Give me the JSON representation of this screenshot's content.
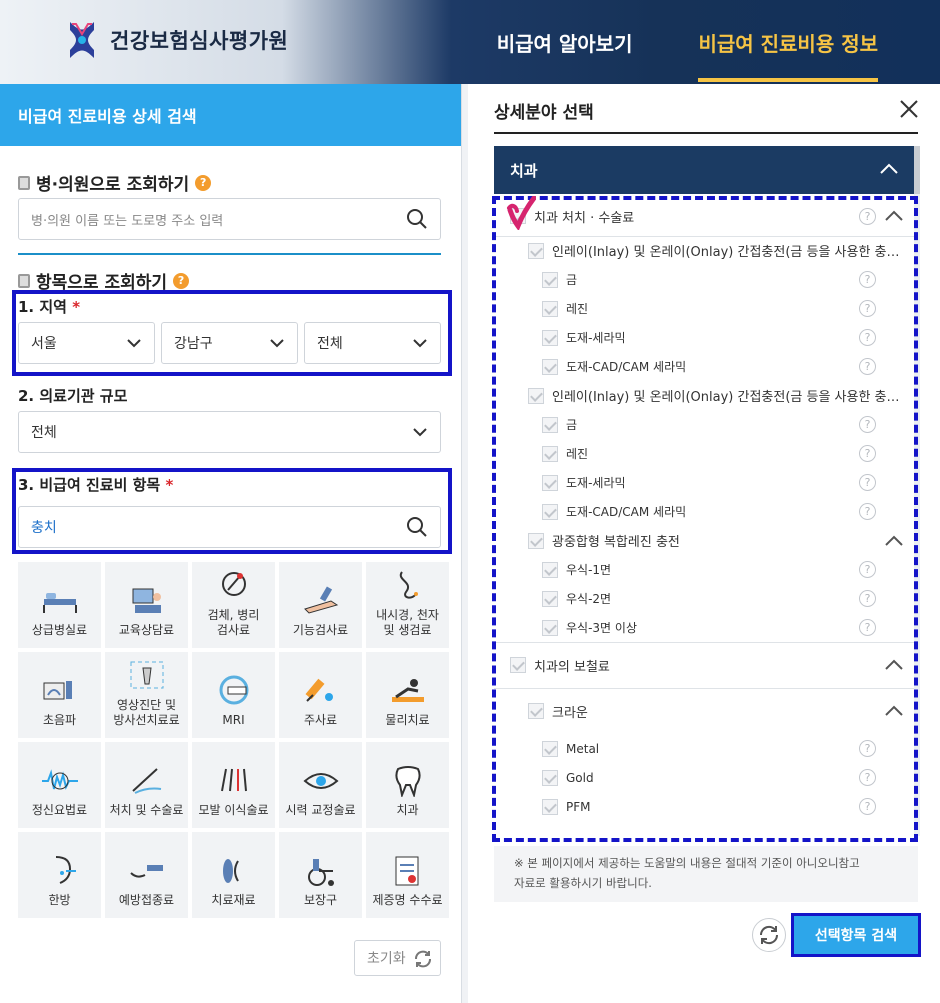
{
  "header": {
    "org_name": "건강보험심사평가원",
    "nav": [
      "비급여 알아보기",
      "비급여 진료비용 정보"
    ],
    "active_nav": 1
  },
  "left": {
    "panel_title": "비급여 진료비용 상세 검색",
    "hospital_section": {
      "title": "병·의원으로 조회하기",
      "placeholder": "병·의원 이름 또는 도로명 주소 입력"
    },
    "item_section": {
      "title": "항목으로 조회하기"
    },
    "region": {
      "label": "1. 지역",
      "required": "*",
      "selects": [
        "서울",
        "강남구",
        "전체"
      ]
    },
    "scale": {
      "label": "2. 의료기관 규모",
      "value": "전체"
    },
    "item": {
      "label": "3. 비급여 진료비 항목",
      "required": "*",
      "value": "충치"
    },
    "categories": [
      {
        "label": "상급병실료",
        "icon": "hospital-bed-icon"
      },
      {
        "label": "교육상담료",
        "icon": "consultation-icon"
      },
      {
        "label": "검체, 병리\n검사료",
        "icon": "microscope-icon"
      },
      {
        "label": "기능검사료",
        "icon": "arm-test-icon"
      },
      {
        "label": "내시경, 천자\n및 생검료",
        "icon": "endoscope-icon"
      },
      {
        "label": "초음파",
        "icon": "ultrasound-icon"
      },
      {
        "label": "영상진단 및\n방사선치료료",
        "icon": "xray-icon"
      },
      {
        "label": "MRI",
        "icon": "mri-icon"
      },
      {
        "label": "주사료",
        "icon": "syringe-icon"
      },
      {
        "label": "물리치료",
        "icon": "physical-therapy-icon"
      },
      {
        "label": "정신요법료",
        "icon": "brain-wave-icon"
      },
      {
        "label": "처치 및 수술료",
        "icon": "surgery-icon"
      },
      {
        "label": "모발 이식술료",
        "icon": "hair-transplant-icon"
      },
      {
        "label": "시력 교정술료",
        "icon": "eye-icon"
      },
      {
        "label": "치과",
        "icon": "tooth-icon"
      },
      {
        "label": "한방",
        "icon": "acupuncture-ear-icon"
      },
      {
        "label": "예방접종료",
        "icon": "vaccine-icon"
      },
      {
        "label": "치료재료",
        "icon": "lens-icon"
      },
      {
        "label": "보장구",
        "icon": "wheelchair-icon"
      },
      {
        "label": "제증명 수수료",
        "icon": "certificate-icon"
      }
    ],
    "reset_label": "초기화"
  },
  "right": {
    "title": "상세분야 선택",
    "group_title": "치과",
    "tree": [
      {
        "level": 0,
        "text": "치과 처치 · 수술료",
        "help": true,
        "collapse": true
      },
      {
        "level": 1,
        "text": "인레이(Inlay) 및 온레이(Onlay) 간접충전(금 등을 사용한 충전…",
        "help": false
      },
      {
        "level": 2,
        "text": "금",
        "help": true
      },
      {
        "level": 2,
        "text": "레진",
        "help": true
      },
      {
        "level": 2,
        "text": "도재-세라믹",
        "help": true
      },
      {
        "level": 2,
        "text": "도재-CAD/CAM 세라믹",
        "help": true
      },
      {
        "level": 1,
        "text": "인레이(Inlay) 및 온레이(Onlay) 간접충전(금 등을 사용한 충전…",
        "help": false
      },
      {
        "level": 2,
        "text": "금",
        "help": true
      },
      {
        "level": 2,
        "text": "레진",
        "help": true
      },
      {
        "level": 2,
        "text": "도재-세라믹",
        "help": true
      },
      {
        "level": 2,
        "text": "도재-CAD/CAM 세라믹",
        "help": true
      },
      {
        "level": 1,
        "text": "광중합형 복합레진 충전",
        "help": false,
        "collapse": true
      },
      {
        "level": 2,
        "text": "우식-1면",
        "help": true
      },
      {
        "level": 2,
        "text": "우식-2면",
        "help": true
      },
      {
        "level": 2,
        "text": "우식-3면 이상",
        "help": true
      },
      {
        "level": 0,
        "text": "치과의 보철료",
        "help": false,
        "collapse": true
      },
      {
        "level": 1,
        "text": "크라운",
        "help": false,
        "collapse": true
      },
      {
        "level": 2,
        "text": "Metal",
        "help": true
      },
      {
        "level": 2,
        "text": "Gold",
        "help": true
      },
      {
        "level": 2,
        "text": "PFM",
        "help": true
      }
    ],
    "notice_line1": "※ 본 페이지에서 제공하는 도움말의 내용은 절대적 기준이 아니오니참고",
    "notice_line2": "자료로 활용하시기 바랍니다.",
    "search_selected_label": "선택항목 검색",
    "help_glyph": "?"
  },
  "colors": {
    "accent": "#2da6ea",
    "navy": "#1b3b63",
    "highlight": "#1414c8",
    "nav_active": "#f6c445"
  }
}
